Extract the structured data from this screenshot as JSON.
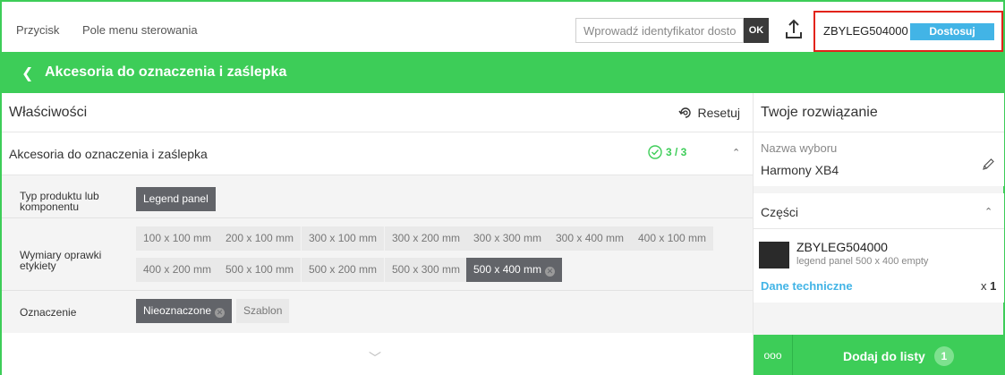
{
  "topbar": {
    "link_button": "Przycisk",
    "link_menu": "Pole menu sterowania",
    "search_placeholder": "Wprowadź identyfikator dosto...",
    "ok_label": "OK",
    "sku": "ZBYLEG504000",
    "customize_label": "Dostosuj"
  },
  "header": {
    "back_icon": "chevron-left-icon",
    "title": "Akcesoria do oznaczenia i zaślepka"
  },
  "properties": {
    "title": "Właściwości",
    "reset_label": "Resetuj",
    "section_title": "Akcesoria do oznaczenia i zaślepka",
    "section_count": "3 / 3",
    "rows": [
      {
        "label": "Typ produktu lub komponentu",
        "options": [
          {
            "label": "Legend panel",
            "selected": true
          }
        ]
      },
      {
        "label": "Wymiary oprawki etykiety",
        "options": [
          {
            "label": "100 x 100 mm",
            "selected": false
          },
          {
            "label": "200 x 100 mm",
            "selected": false
          },
          {
            "label": "300 x 100 mm",
            "selected": false
          },
          {
            "label": "300 x 200 mm",
            "selected": false
          },
          {
            "label": "300 x 300 mm",
            "selected": false
          },
          {
            "label": "300 x 400 mm",
            "selected": false
          },
          {
            "label": "400 x 100 mm",
            "selected": false
          },
          {
            "label": "400 x 200 mm",
            "selected": false
          },
          {
            "label": "500 x 100 mm",
            "selected": false
          },
          {
            "label": "500 x 200 mm",
            "selected": false
          },
          {
            "label": "500 x 300 mm",
            "selected": false
          },
          {
            "label": "500 x 400 mm",
            "selected": true
          }
        ]
      },
      {
        "label": "Oznaczenie",
        "options": [
          {
            "label": "Nieoznaczone",
            "selected": true
          },
          {
            "label": "Szablon",
            "selected": false
          }
        ]
      }
    ]
  },
  "solution": {
    "title": "Twoje rozwiązanie",
    "name_label": "Nazwa wyboru",
    "name_value": "Harmony XB4",
    "parts_title": "Części",
    "part": {
      "sku": "ZBYLEG504000",
      "description": "legend panel 500 x 400 empty",
      "tech_link": "Dane techniczne",
      "qty_prefix": "x",
      "qty": "1"
    },
    "dots_label": "ooo",
    "add_label": "Dodaj do listy",
    "add_count": "1"
  },
  "colors": {
    "brand_green": "#3dcd58",
    "accent_blue": "#42b4e6",
    "highlight_red": "#e2231a"
  }
}
